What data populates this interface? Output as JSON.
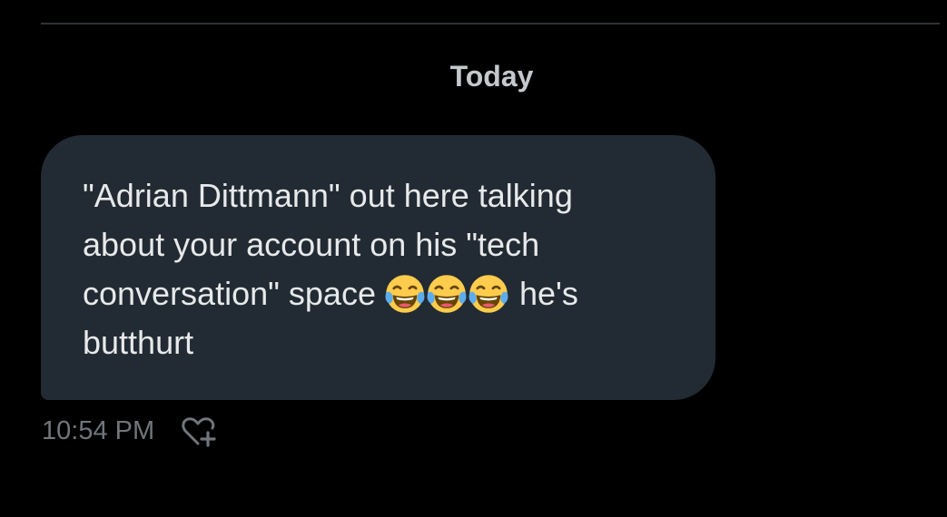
{
  "conversation": {
    "date_separator": "Today"
  },
  "message": {
    "text_part1": "\"Adrian Dittmann\" out here talking\nabout your account on his \"tech\nconversation\" space ",
    "emojis": [
      "face-with-tears-of-joy",
      "face-with-tears-of-joy",
      "face-with-tears-of-joy"
    ],
    "text_part2": " he's\nbutthurt",
    "timestamp": "10:54 PM",
    "react_icon": "heart-plus-icon"
  },
  "colors": {
    "background": "#000000",
    "bubble": "#222b33",
    "text": "#e7e9ea",
    "muted": "#71767b",
    "divider": "#2f3336"
  }
}
